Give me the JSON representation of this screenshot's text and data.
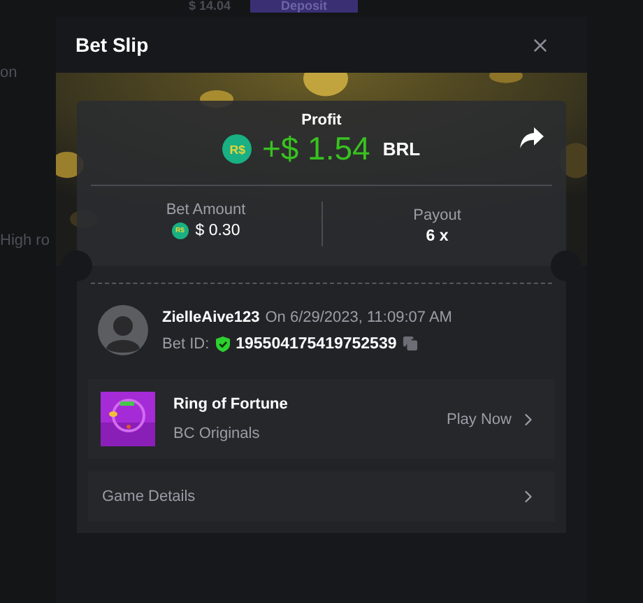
{
  "background": {
    "balance": "$ 14.04",
    "deposit_button": "Deposit",
    "side_texts": [
      "on",
      "High ro"
    ]
  },
  "modal": {
    "title": "Bet Slip"
  },
  "profit": {
    "label": "Profit",
    "badge": "R$",
    "amount": "+$ 1.54",
    "currency": "BRL"
  },
  "bet_amount": {
    "label": "Bet Amount",
    "badge": "R$",
    "value": "$ 0.30"
  },
  "payout": {
    "label": "Payout",
    "value": "6 x"
  },
  "bet_info": {
    "user": "ZielleAive123",
    "date": "On 6/29/2023, 11:09:07 AM",
    "bet_id_label": "Bet ID:",
    "bet_id": "195504175419752539"
  },
  "game": {
    "name": "Ring of Fortune",
    "provider": "BC Originals",
    "action": "Play Now"
  },
  "details": {
    "label": "Game Details"
  }
}
